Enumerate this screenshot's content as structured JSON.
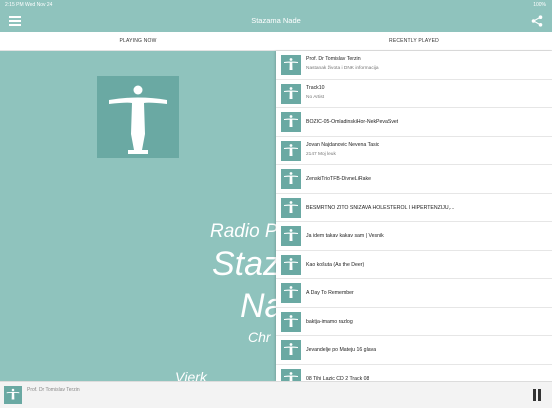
{
  "status_bar": {
    "time": "2:15 PM  Wed Nov 24",
    "battery": "100%"
  },
  "app_bar": {
    "title": "Stazama Nade"
  },
  "tabs": {
    "now_playing": "PLAYING NOW",
    "recently_played": "RECENTLY PLAYED"
  },
  "station": {
    "line1": "Radio P",
    "line2": "Staz",
    "line3": "Na",
    "line4": "Chr",
    "line5": "Vjerk"
  },
  "colors": {
    "primary": "#8fc3bd",
    "logo_bg": "#6aa9a3"
  },
  "recent": [
    {
      "title": "Prof. Dr Tomislav Terzin",
      "artist": "Nastanak života i DNK informacija"
    },
    {
      "title": "Track10",
      "artist": "No Artist"
    },
    {
      "title": "BOZIC-05-OmladinskiHor-NekPevaSvet",
      "artist": ""
    },
    {
      "title": "Jovan Najdanovic Nevena Tasic",
      "artist": "2147 Moj leuk"
    },
    {
      "title": "ZenskiTrioTFB-DivneLiRake",
      "artist": ""
    },
    {
      "title": "BESMRTNO ŽITO SNIŽAVA HOLESTEROL I HIPERTENZIJU,...",
      "artist": ""
    },
    {
      "title": "Ja idem takav kakav sam  | Vesnik",
      "artist": ""
    },
    {
      "title": "Kao košuta (As the Deer)",
      "artist": ""
    },
    {
      "title": "A Day To Remember",
      "artist": ""
    },
    {
      "title": "baktja-imamo razlog",
      "artist": ""
    },
    {
      "title": "Jevandelje po Mateju 16 glava",
      "artist": ""
    },
    {
      "title": "08 Tihi Lazic CD 2 Track 08",
      "artist": ""
    }
  ],
  "player": {
    "title": "Prof. Dr Tomislav Terzin",
    "control_icon": "pause-icon"
  }
}
